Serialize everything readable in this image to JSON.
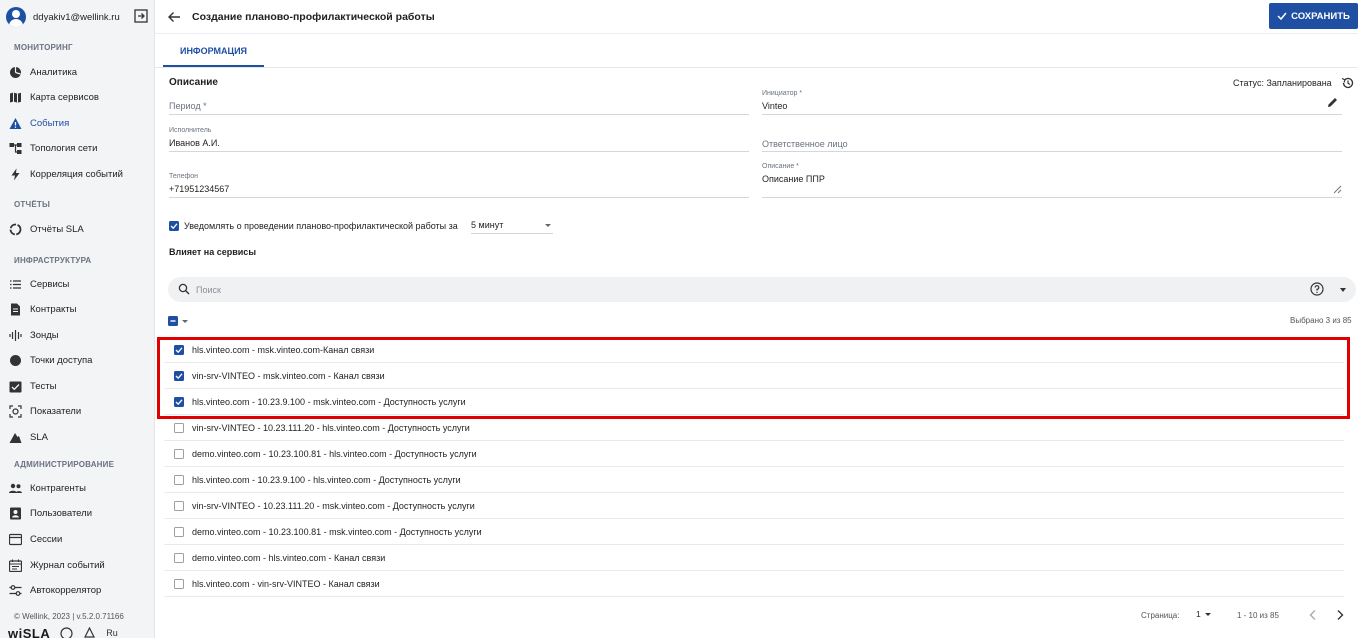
{
  "user": {
    "email": "ddyakiv1@wellink.ru"
  },
  "sidebar": {
    "sections": [
      {
        "title": "МОНИТОРИНГ"
      },
      {
        "title": "ОТЧЁТЫ"
      },
      {
        "title": "ИНФРАСТРУКТУРА"
      },
      {
        "title": "АДМИНИСТРИРОВАНИЕ"
      }
    ],
    "items": [
      {
        "label": "Аналитика",
        "icon": "pie-chart-icon"
      },
      {
        "label": "Карта сервисов",
        "icon": "map-icon"
      },
      {
        "label": "События",
        "icon": "warning-icon",
        "active": true
      },
      {
        "label": "Топология сети",
        "icon": "topology-icon"
      },
      {
        "label": "Корреляция событий",
        "icon": "bolt-icon"
      },
      {
        "label": "Отчёты SLA",
        "icon": "circle-progress-icon"
      },
      {
        "label": "Сервисы",
        "icon": "list-icon"
      },
      {
        "label": "Контракты",
        "icon": "document-icon"
      },
      {
        "label": "Зонды",
        "icon": "probe-icon"
      },
      {
        "label": "Точки доступа",
        "icon": "dot-icon"
      },
      {
        "label": "Тесты",
        "icon": "checklist-icon"
      },
      {
        "label": "Показатели",
        "icon": "metrics-icon"
      },
      {
        "label": "SLA",
        "icon": "sla-icon"
      },
      {
        "label": "Контрагенты",
        "icon": "people-icon"
      },
      {
        "label": "Пользователи",
        "icon": "user-card-icon"
      },
      {
        "label": "Сессии",
        "icon": "session-icon"
      },
      {
        "label": "Журнал событий",
        "icon": "calendar-icon"
      },
      {
        "label": "Автокоррелятор",
        "icon": "sliders-icon"
      }
    ],
    "footer": {
      "version": "© Wellink, 2023 | v.5.2.0.71166",
      "logo": "wiSLA",
      "lang": "Ru"
    }
  },
  "header": {
    "title": "Создание планово-профилактической работы",
    "save_label": "СОХРАНИТЬ"
  },
  "tabs": [
    {
      "label": "ИНФОРМАЦИЯ"
    }
  ],
  "form": {
    "section_title": "Описание",
    "status": "Статус: Запланирована",
    "period": {
      "placeholder": "Период *"
    },
    "initiator": {
      "label": "Инициатор *",
      "value": "Vinteo"
    },
    "executor": {
      "label": "Исполнитель",
      "value": "Иванов А.И."
    },
    "responsible": {
      "placeholder": "Ответственное лицо"
    },
    "phone": {
      "label": "Телефон",
      "value": "+71951234567"
    },
    "description": {
      "label": "Описание *",
      "value": "Описание ППР"
    },
    "notify": {
      "label": "Уведомлять о проведении планово-профилактической работы за",
      "minutes": "5 минут",
      "checked": true
    }
  },
  "services": {
    "title": "Влияет на сервисы",
    "search_placeholder": "Поиск",
    "selected_count": "Выбрано 3 из 85",
    "rows": [
      {
        "label": "hls.vinteo.com - msk.vinteo.com-Канал связи",
        "checked": true
      },
      {
        "label": "vin-srv-VINTEO - msk.vinteo.com - Канал связи",
        "checked": true
      },
      {
        "label": "hls.vinteo.com - 10.23.9.100 - msk.vinteo.com - Доступность услуги",
        "checked": true
      },
      {
        "label": "vin-srv-VINTEO - 10.23.111.20 - hls.vinteo.com - Доступность услуги",
        "checked": false
      },
      {
        "label": "demo.vinteo.com - 10.23.100.81 - hls.vinteo.com - Доступность услуги",
        "checked": false
      },
      {
        "label": "hls.vinteo.com - 10.23.9.100 - hls.vinteo.com - Доступность услуги",
        "checked": false
      },
      {
        "label": "vin-srv-VINTEO - 10.23.111.20 - msk.vinteo.com - Доступность услуги",
        "checked": false
      },
      {
        "label": "demo.vinteo.com - 10.23.100.81 - msk.vinteo.com - Доступность услуги",
        "checked": false
      },
      {
        "label": "demo.vinteo.com - hls.vinteo.com - Канал связи",
        "checked": false
      },
      {
        "label": "hls.vinteo.com - vin-srv-VINTEO - Канал связи",
        "checked": false
      }
    ],
    "pagination": {
      "page_label": "Страница:",
      "page": "1",
      "range": "1 - 10 из 85"
    }
  },
  "colors": {
    "accent": "#1f4fa3",
    "highlight": "#e00000"
  }
}
